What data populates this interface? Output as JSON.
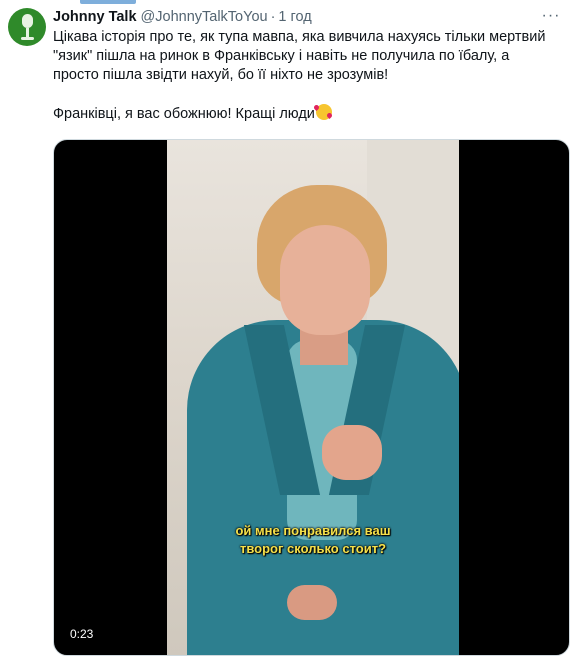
{
  "tweet": {
    "author_name": "Johnny Talk",
    "handle": "@JohnnyTalkToYou",
    "separator": "·",
    "time": "1 год",
    "more_icon": "more-horizontal-icon",
    "text_line_1": "Цікава історія про те, як тупа мавпа, яка вивчила нахуясь тільки мертвий",
    "text_line_2": "\"язик\" пішла на ринок в Франківську і навіть не получила по їбалу, а",
    "text_line_3": "просто пішла звідти нахуй, бо її ніхто не зрозумів!",
    "text_line_4": "Франківці, я вас обожнюю! Кращі люди"
  },
  "media": {
    "subtitle_line_1": "ой мне понравился ваш",
    "subtitle_line_2": "творог сколько стоит?",
    "duration": "0:23"
  },
  "colors": {
    "accent_bar": "#7eaedb",
    "subtitle": "#f5e04a",
    "secondary_text": "#536471"
  }
}
